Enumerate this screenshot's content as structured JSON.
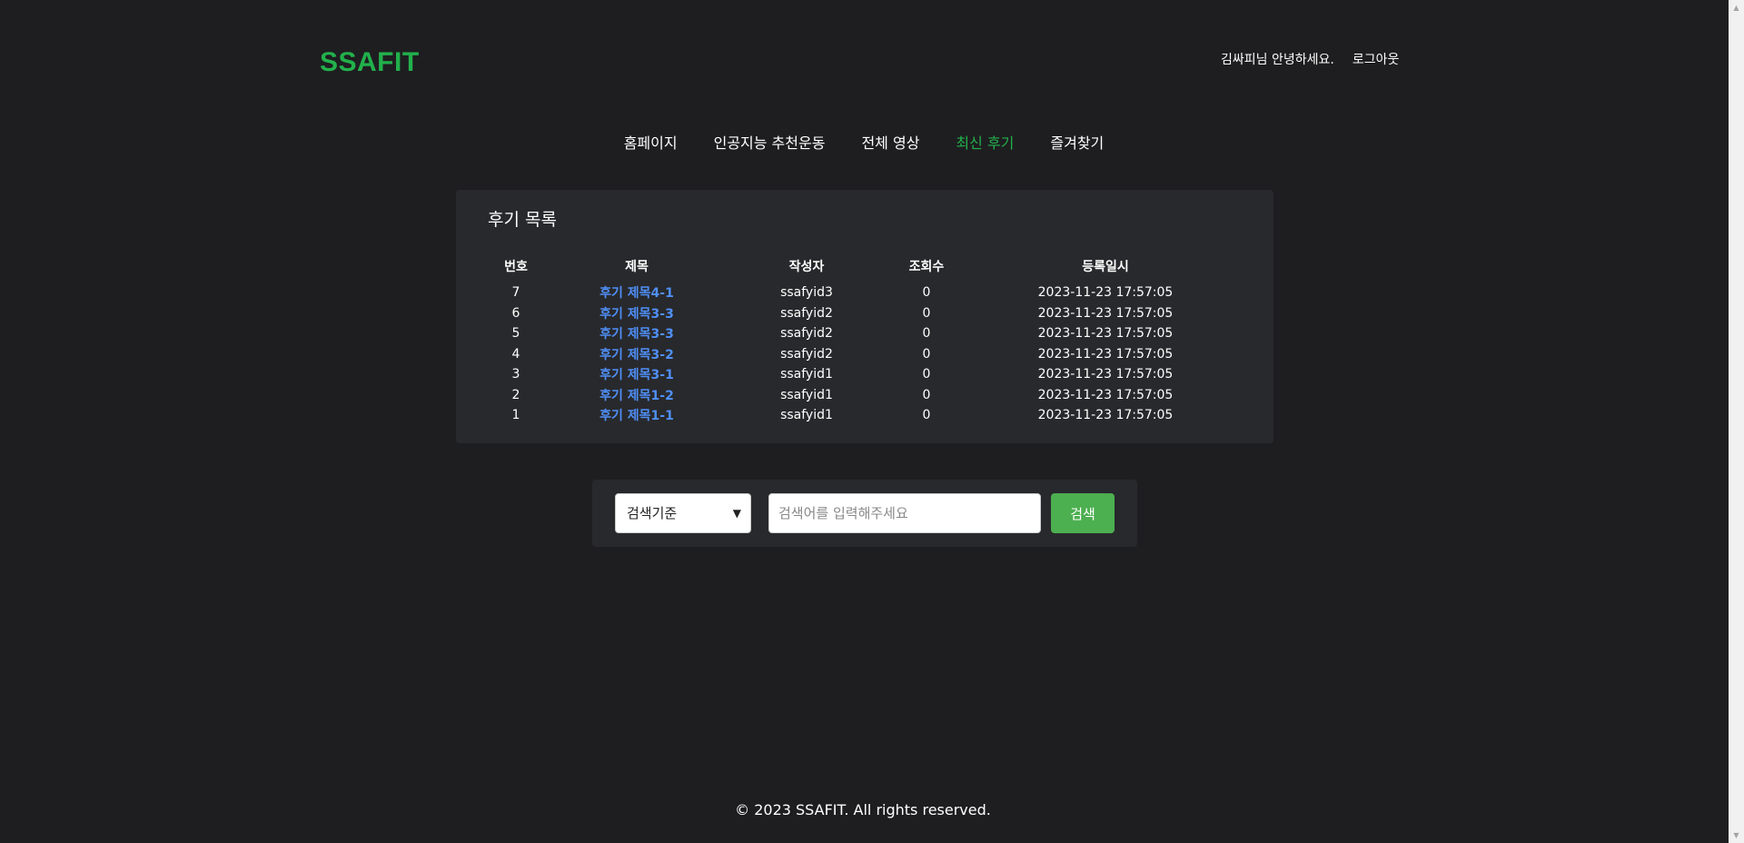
{
  "header": {
    "logo": "SSAFIT",
    "greeting": "김싸피님 안녕하세요.",
    "logout": "로그아웃"
  },
  "nav": {
    "items": [
      {
        "label": "홈페이지",
        "active": false
      },
      {
        "label": "인공지능 추천운동",
        "active": false
      },
      {
        "label": "전체 영상",
        "active": false
      },
      {
        "label": "최신 후기",
        "active": true
      },
      {
        "label": "즐겨찾기",
        "active": false
      }
    ]
  },
  "reviews": {
    "title": "후기 목록",
    "columns": [
      "번호",
      "제목",
      "작성자",
      "조회수",
      "등록일시"
    ],
    "rows": [
      {
        "num": "7",
        "title": "후기 제목4-1",
        "author": "ssafyid3",
        "views": "0",
        "date": "2023-11-23 17:57:05"
      },
      {
        "num": "6",
        "title": "후기 제목3-3",
        "author": "ssafyid2",
        "views": "0",
        "date": "2023-11-23 17:57:05"
      },
      {
        "num": "5",
        "title": "후기 제목3-3",
        "author": "ssafyid2",
        "views": "0",
        "date": "2023-11-23 17:57:05"
      },
      {
        "num": "4",
        "title": "후기 제목3-2",
        "author": "ssafyid2",
        "views": "0",
        "date": "2023-11-23 17:57:05"
      },
      {
        "num": "3",
        "title": "후기 제목3-1",
        "author": "ssafyid1",
        "views": "0",
        "date": "2023-11-23 17:57:05"
      },
      {
        "num": "2",
        "title": "후기 제목1-2",
        "author": "ssafyid1",
        "views": "0",
        "date": "2023-11-23 17:57:05"
      },
      {
        "num": "1",
        "title": "후기 제목1-1",
        "author": "ssafyid1",
        "views": "0",
        "date": "2023-11-23 17:57:05"
      }
    ]
  },
  "search": {
    "select_value": "검색기준",
    "placeholder": "검색어를 입력해주세요",
    "button_label": "검색"
  },
  "footer": {
    "text": "© 2023 SSAFIT. All rights reserved."
  },
  "colors": {
    "brand": "#22b14c",
    "link": "#4f8ff7",
    "button": "#4caf50",
    "background": "#1e1e20",
    "panel": "#28292c"
  },
  "icons": {
    "select_chevron": "chevron-down-icon"
  }
}
